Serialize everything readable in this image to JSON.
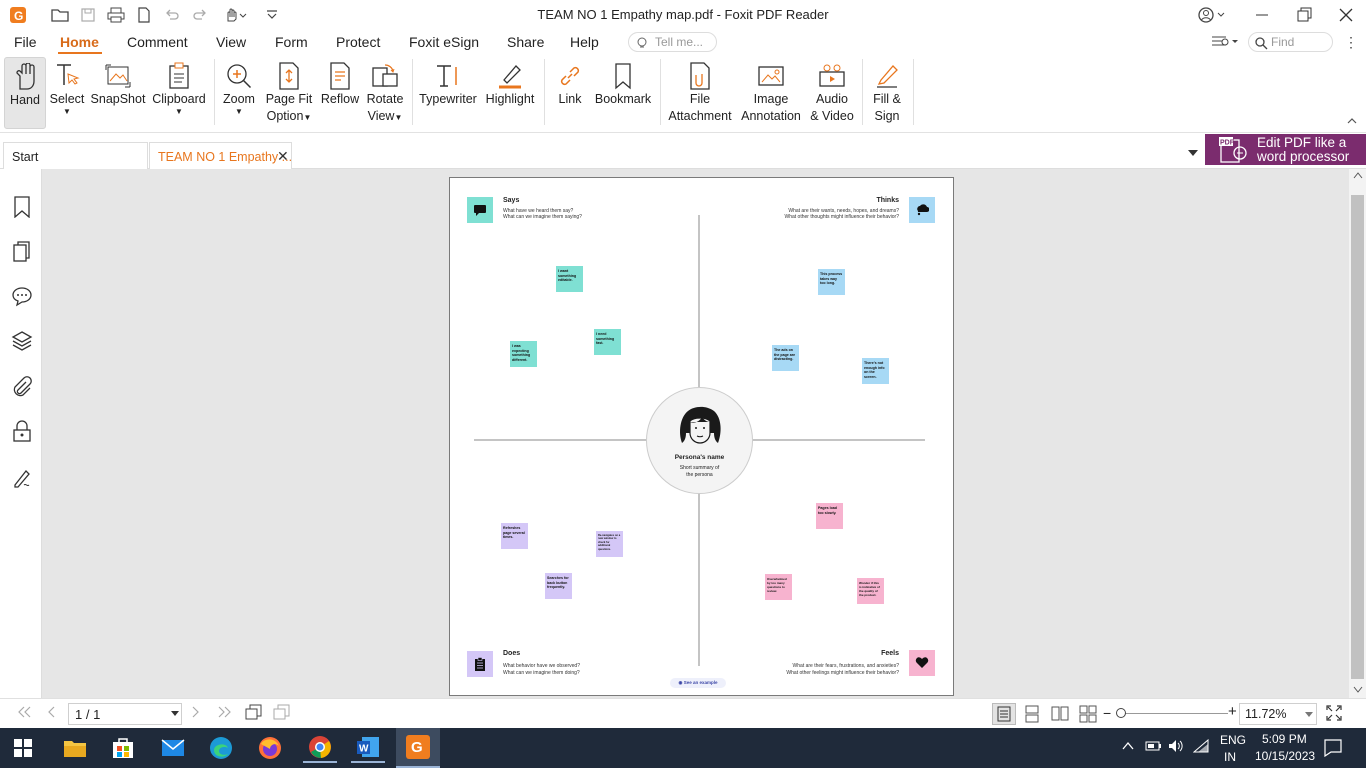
{
  "window": {
    "title": "TEAM NO 1 Empathy map.pdf - Foxit PDF Reader"
  },
  "menu": {
    "items": [
      "File",
      "Home",
      "Comment",
      "View",
      "Form",
      "Protect",
      "Foxit eSign",
      "Share",
      "Help"
    ],
    "tell_me_placeholder": "Tell me...",
    "find_placeholder": "Find"
  },
  "ribbon": {
    "hand": "Hand",
    "select": "Select",
    "snapshot": "SnapShot",
    "clipboard": "Clipboard",
    "zoom": "Zoom",
    "page_fit_1": "Page Fit",
    "page_fit_2": "Option",
    "reflow": "Reflow",
    "rotate_1": "Rotate",
    "rotate_2": "View",
    "typewriter": "Typewriter",
    "highlight": "Highlight",
    "link": "Link",
    "bookmark": "Bookmark",
    "file_att_1": "File",
    "file_att_2": "Attachment",
    "image_ann_1": "Image",
    "image_ann_2": "Annotation",
    "audio_1": "Audio",
    "audio_2": "& Video",
    "fill_1": "Fill &",
    "fill_2": "Sign"
  },
  "tabs": {
    "start": "Start",
    "doc": "TEAM NO 1 Empathy ..."
  },
  "promo": {
    "line1": "Edit PDF like a",
    "line2": "word processor"
  },
  "doc": {
    "says": {
      "title": "Says",
      "q1": "What have we heard them say?",
      "q2": "What can we imagine them saying?"
    },
    "thinks": {
      "title": "Thinks",
      "q1": "What are their wants, needs, hopes, and dreams?",
      "q2": "What other thoughts might influence their behavior?"
    },
    "does": {
      "title": "Does",
      "q1": "What behavior have we observed?",
      "q2": "What can we imagine them doing?"
    },
    "feels": {
      "title": "Feels",
      "q1": "What are their fears, frustrations, and anxieties?",
      "q2": "What other feelings might influence their behavior?"
    },
    "persona": {
      "name": "Persona's name",
      "summary1": "Short summary of",
      "summary2": "the persona"
    },
    "see_example": "See an example",
    "notes": {
      "n1": "I want something editable.",
      "n2": "I was expecting something different.",
      "n3": "I need something fast.",
      "n4": "This process takes way too long.",
      "n5": "The ads on the page are distracting.",
      "n6": "There's not enough info on the screen.",
      "n7": "Refreshes page several times.",
      "n8": "Re-navigates on a new window to check for additional questions.",
      "n9": "Searches for back button frequently.",
      "n10": "Pages load too slowly.",
      "n11": "Overwhelmed by too many questions to review.",
      "n12": "Wonder if this is indicative of the quality of the product."
    }
  },
  "status": {
    "page": "1 / 1",
    "zoom": "11.72%"
  },
  "tray": {
    "lang1": "ENG",
    "lang2": "IN",
    "time": "5:09 PM",
    "date": "10/15/2023"
  },
  "colors": {
    "accent": "#e8761e",
    "teal": "#7fe0d3",
    "blue": "#a7d9f5",
    "purple": "#d4c7f7",
    "pink": "#f7b3cf",
    "promo": "#7b2c6e",
    "taskbar": "#1f2a3a"
  }
}
